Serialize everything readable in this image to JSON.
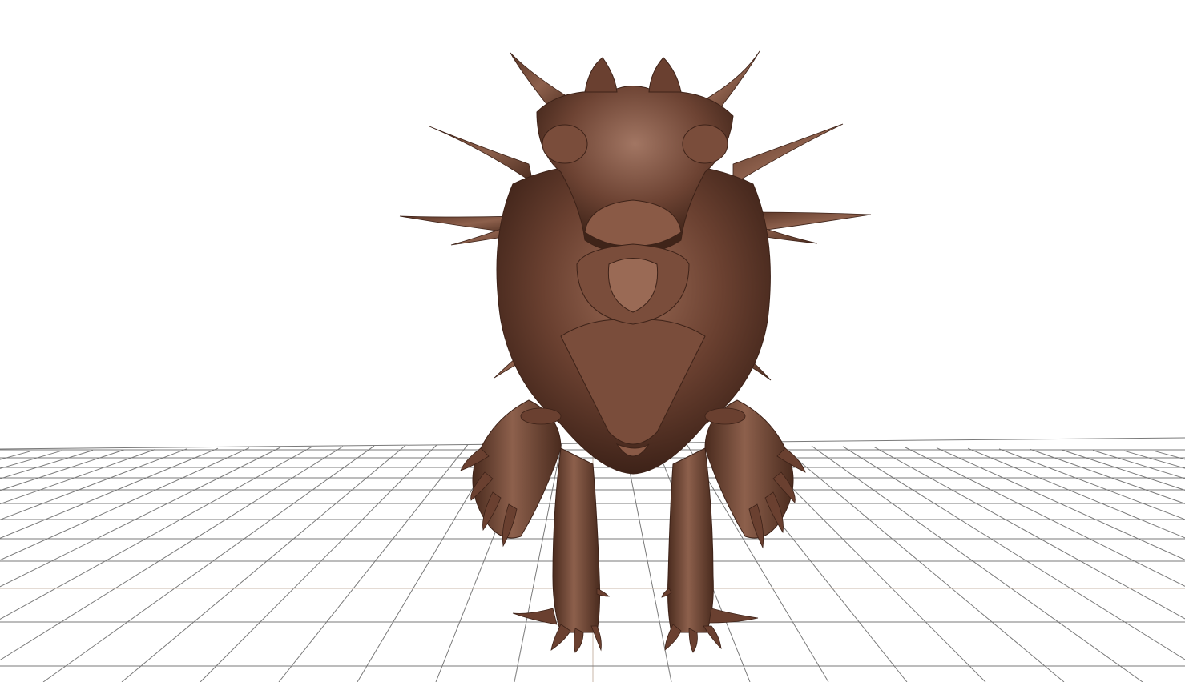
{
  "viewport": {
    "background": "#ffffff",
    "grid_color": "#7a7a7a",
    "axis_color": "#c9b7a8"
  },
  "model": {
    "kind": "spiked-creature-sculpt",
    "base_color": "#6a4030",
    "shadow_color": "#3d2218",
    "highlight_color": "#b08570"
  }
}
